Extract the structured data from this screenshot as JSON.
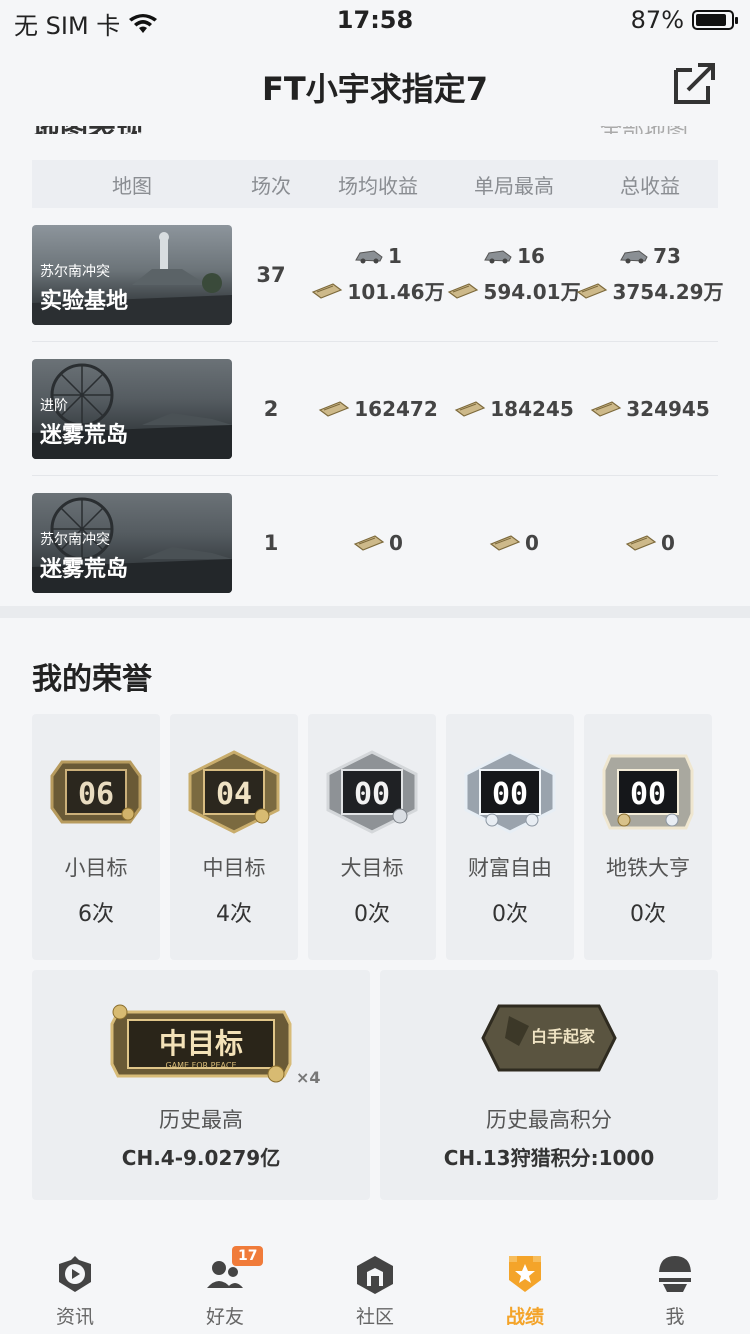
{
  "status_bar": {
    "carrier": "无 SIM 卡",
    "time": "17:58",
    "battery": "87%",
    "battery_level": 0.87
  },
  "header": {
    "title": "FT小宇求指定7"
  },
  "section_peek": {
    "title": "地图表现",
    "right": "全部地图"
  },
  "table": {
    "columns": [
      "地图",
      "场次",
      "场均收益",
      "单局最高",
      "总收益"
    ],
    "rows": [
      {
        "mode": "苏尔南冲突",
        "map": "实验基地",
        "count": "37",
        "avg_car": "1",
        "avg_cash": "101.46万",
        "max_car": "16",
        "max_cash": "594.01万",
        "tot_car": "73",
        "tot_cash": "3754.29万"
      },
      {
        "mode": "进阶",
        "map": "迷雾荒岛",
        "count": "2",
        "avg_cash": "162472",
        "max_cash": "184245",
        "tot_cash": "324945"
      },
      {
        "mode": "苏尔南冲突",
        "map": "迷雾荒岛",
        "count": "1",
        "avg_cash": "0",
        "max_cash": "0",
        "tot_cash": "0"
      }
    ]
  },
  "honors": {
    "title": "我的荣誉",
    "items": [
      {
        "badge": "06",
        "label": "小目标",
        "count": "6次"
      },
      {
        "badge": "04",
        "label": "中目标",
        "count": "4次"
      },
      {
        "badge": "00",
        "label": "大目标",
        "count": "0次"
      },
      {
        "badge": "00",
        "label": "财富自由",
        "count": "0次"
      },
      {
        "badge": "00",
        "label": "地铁大亨",
        "count": "0次"
      }
    ],
    "history": [
      {
        "badge_text": "中目标",
        "badge_sub": "GAME FOR PEACE",
        "multiplier": "×4",
        "label": "历史最高",
        "value": "CH.4-9.0279亿"
      },
      {
        "badge_text": "白手起家",
        "label": "历史最高积分",
        "value": "CH.13狩猎积分:1000"
      }
    ]
  },
  "tabbar": {
    "items": [
      {
        "label": "资讯",
        "icon": "news-icon"
      },
      {
        "label": "好友",
        "icon": "friends-icon",
        "badge": "17"
      },
      {
        "label": "社区",
        "icon": "community-icon"
      },
      {
        "label": "战绩",
        "icon": "record-icon",
        "active": true
      },
      {
        "label": "我",
        "icon": "profile-icon"
      }
    ],
    "accent": "#f4a42a"
  }
}
